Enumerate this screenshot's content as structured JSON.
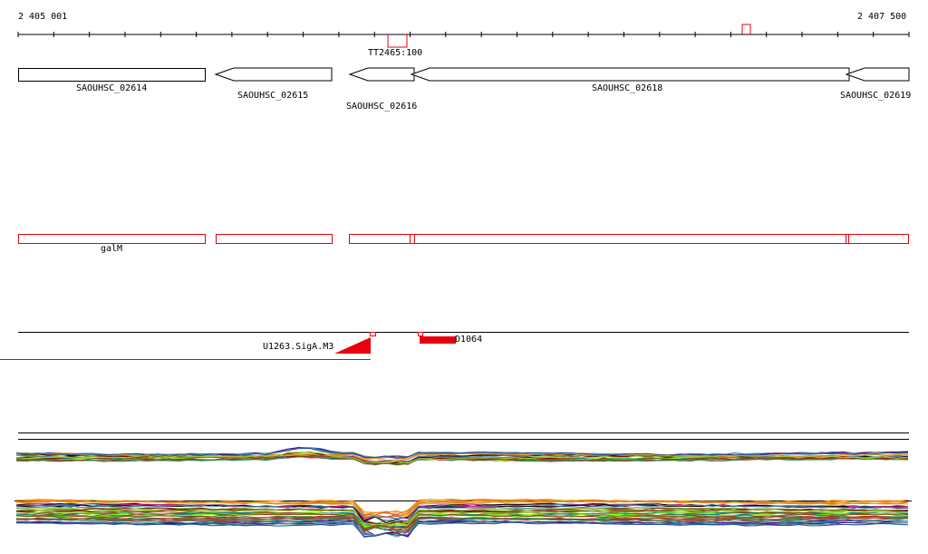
{
  "ruler": {
    "start_label": "2 405 001",
    "end_label": "2 407 500"
  },
  "terminator": {
    "label": "TT2465:100"
  },
  "genes": [
    {
      "label": "SAOUHSC_02614"
    },
    {
      "label": "SAOUHSC_02615"
    },
    {
      "label": "SAOUHSC_02616"
    },
    {
      "label": "SAOUHSC_02618"
    },
    {
      "label": "SAOUHSC_02619"
    }
  ],
  "annotation_track": {
    "label": "galM"
  },
  "feature_track": {
    "left_label": "U1263.SigA.M3",
    "right_label": "D1064"
  },
  "colors": {
    "feature": "#e8000b",
    "annotation": "#e8000b",
    "gene": "#000000"
  }
}
